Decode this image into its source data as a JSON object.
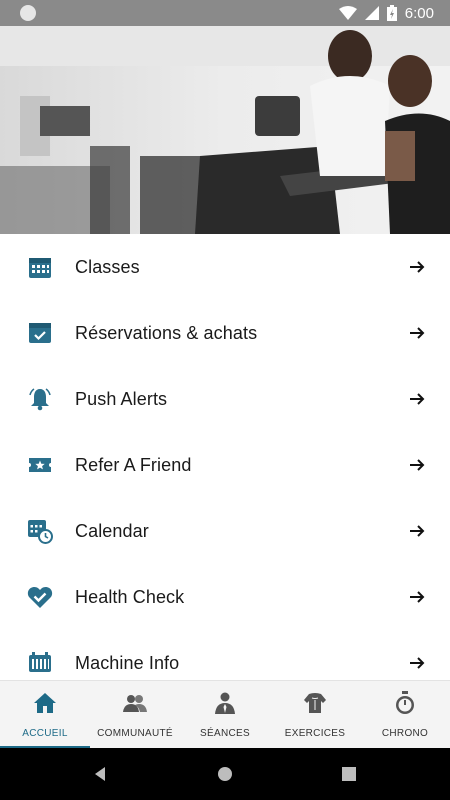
{
  "status_bar": {
    "time": "6:00"
  },
  "menu": {
    "items": [
      {
        "label": "Classes",
        "icon": "calendar-grid-icon"
      },
      {
        "label": "Réservations & achats",
        "icon": "booking-check-icon"
      },
      {
        "label": "Push Alerts",
        "icon": "bell-icon"
      },
      {
        "label": "Refer A Friend",
        "icon": "ticket-star-icon"
      },
      {
        "label": "Calendar",
        "icon": "calendar-clock-icon"
      },
      {
        "label": "Health Check",
        "icon": "heart-check-icon"
      },
      {
        "label": "Machine Info",
        "icon": "machine-icon"
      }
    ]
  },
  "bottom_nav": {
    "tabs": [
      {
        "label": "ACCUEIL",
        "icon": "home-icon",
        "active": true
      },
      {
        "label": "COMMUNAUTÉ",
        "icon": "community-icon",
        "active": false
      },
      {
        "label": "SÉANCES",
        "icon": "coach-icon",
        "active": false
      },
      {
        "label": "EXERCICES",
        "icon": "torso-icon",
        "active": false
      },
      {
        "label": "CHRONO",
        "icon": "stopwatch-icon",
        "active": false
      }
    ]
  },
  "colors": {
    "accent": "#1d6a87",
    "icon": "#2a6f8c",
    "status_bar": "#8a8a8a",
    "nav_bar": "#000000"
  }
}
